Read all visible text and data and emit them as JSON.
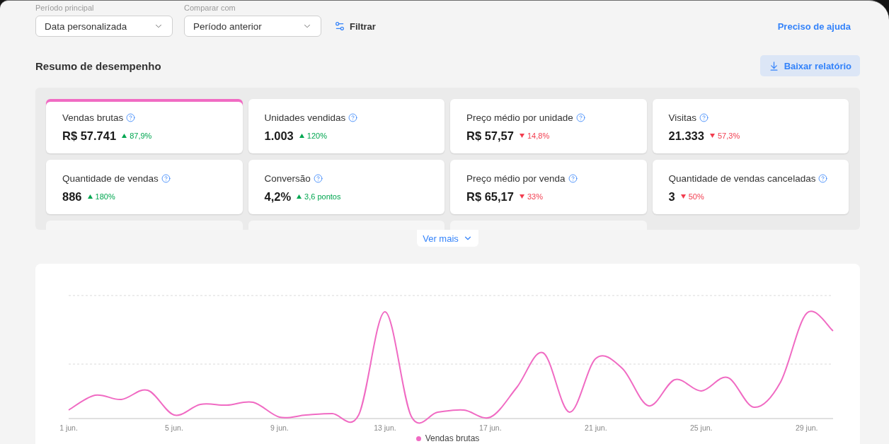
{
  "filters": [
    {
      "label": "Período principal",
      "value": "Data personalizada"
    },
    {
      "label": "Comparar com",
      "value": "Período anterior"
    }
  ],
  "filter_button": "Filtrar",
  "help_link": "Preciso de ajuda",
  "summary": {
    "title": "Resumo de desempenho",
    "download_button": "Baixar relatório"
  },
  "metrics": [
    {
      "label": "Vendas brutas",
      "value": "R$ 57.741",
      "change": "87,9%",
      "increase": true,
      "selected": true
    },
    {
      "label": "Unidades vendidas",
      "value": "1.003",
      "change": "120%",
      "increase": true,
      "selected": false
    },
    {
      "label": "Preço médio por unidade",
      "value": "R$ 57,57",
      "change": "14,8%",
      "increase": false,
      "selected": false
    },
    {
      "label": "Visitas",
      "value": "21.333",
      "change": "57,3%",
      "increase": false,
      "selected": false
    },
    {
      "label": "Quantidade de vendas",
      "value": "886",
      "change": "180%",
      "increase": true,
      "selected": false
    },
    {
      "label": "Conversão",
      "value": "4,2%",
      "change": "3,6 pontos",
      "increase": true,
      "selected": false
    },
    {
      "label": "Preço médio por venda",
      "value": "R$ 65,17",
      "change": "33%",
      "increase": false,
      "selected": false
    },
    {
      "label": "Quantidade de vendas canceladas",
      "value": "3",
      "change": "50%",
      "increase": false,
      "selected": false
    }
  ],
  "partial_cards": [
    {
      "kind": "card"
    },
    {
      "kind": "card"
    },
    {
      "kind": "card"
    }
  ],
  "see_more": "Ver mais",
  "chart": {
    "x_labels": [
      "1 jun.",
      "5 jun.",
      "9 jun.",
      "13 jun.",
      "17 jun.",
      "21 jun.",
      "25 jun.",
      "29 jun."
    ],
    "legend": "Vendas brutas"
  }
}
